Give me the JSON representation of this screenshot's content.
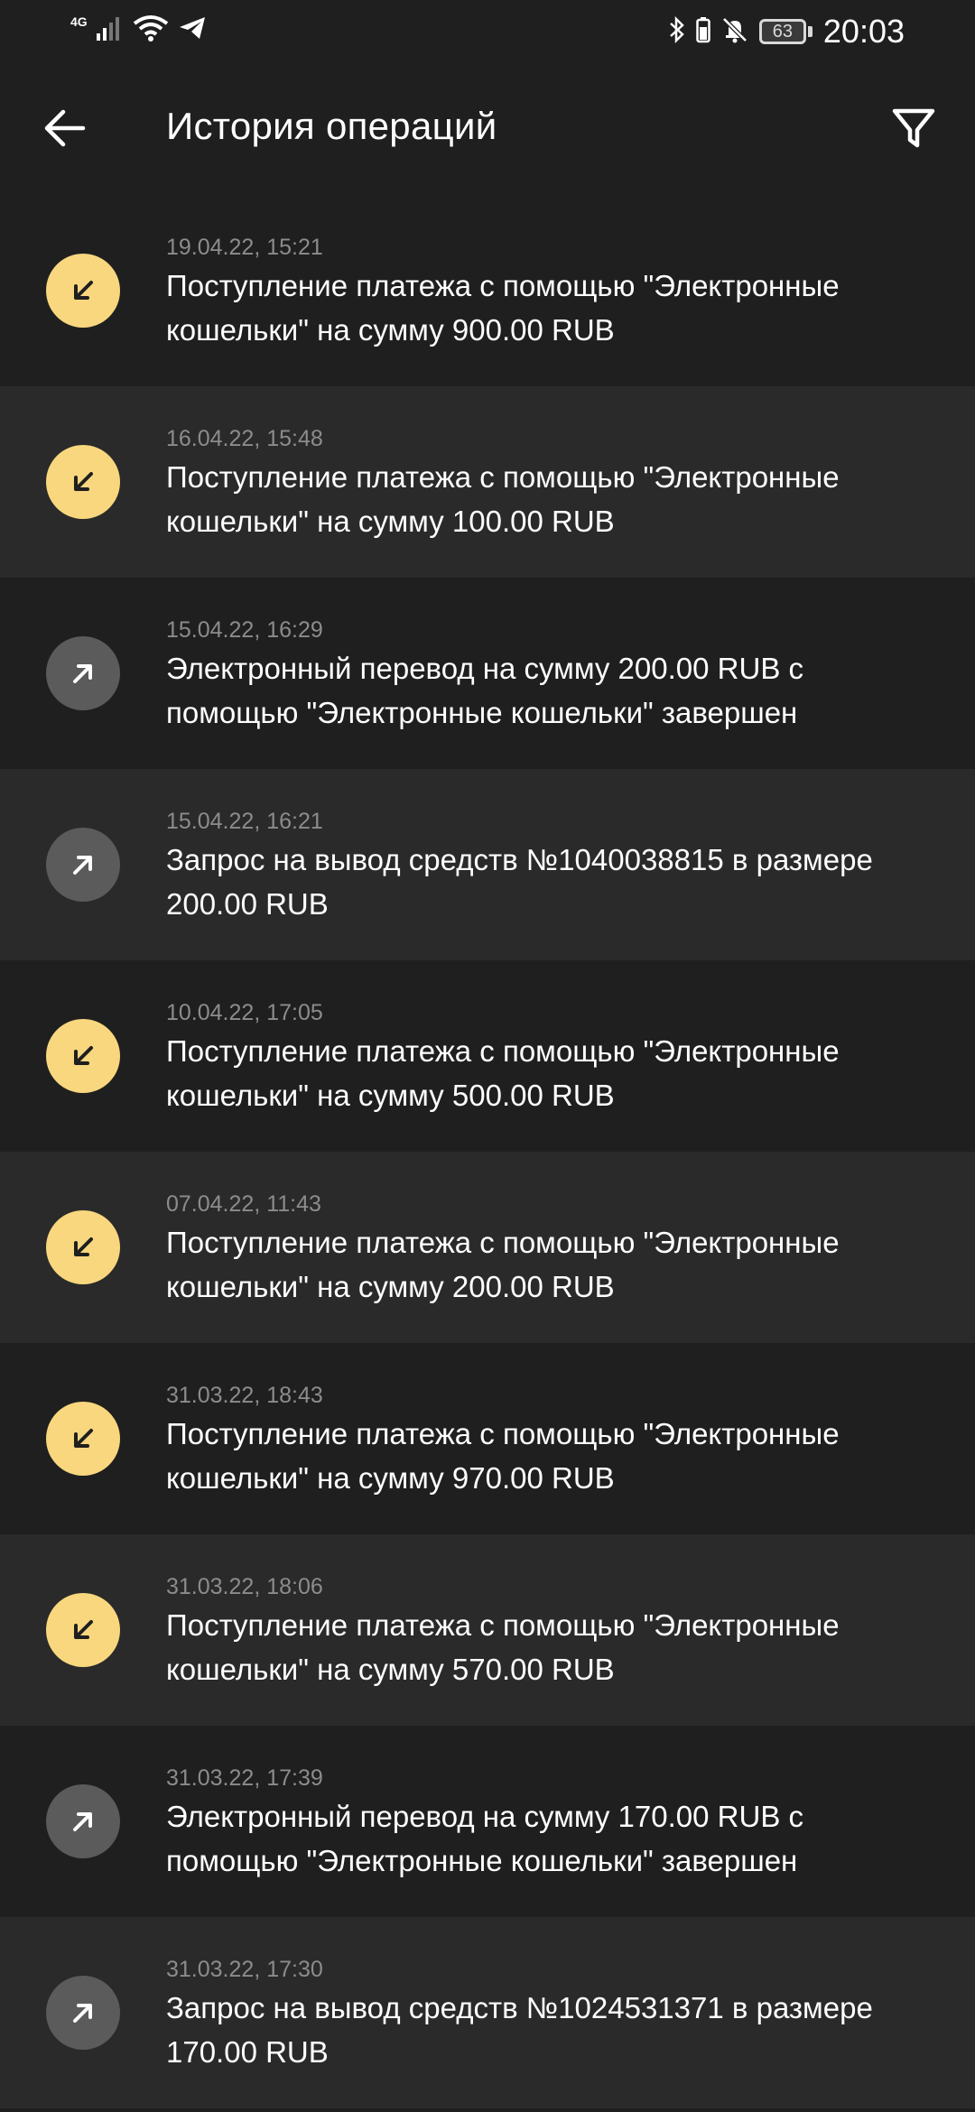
{
  "status_bar": {
    "network": "4G",
    "battery": "63",
    "time": "20:03"
  },
  "header": {
    "title": "История операций",
    "back_icon": "arrow-left-icon",
    "filter_icon": "filter-icon"
  },
  "colors": {
    "incoming": "#f9d77e",
    "outgoing": "#5b5b5b",
    "background": "#1f1f1f",
    "row_alt": "#2a2a2a"
  },
  "operations": [
    {
      "type": "incoming",
      "date": "19.04.22, 15:21",
      "text": "Поступление платежа с помощью \"Электронные кошельки\" на сумму 900.00 RUB"
    },
    {
      "type": "incoming",
      "date": "16.04.22, 15:48",
      "text": "Поступление платежа с помощью \"Электронные кошельки\" на сумму 100.00 RUB"
    },
    {
      "type": "outgoing",
      "date": "15.04.22, 16:29",
      "text": "Электронный перевод на сумму 200.00 RUB с помощью \"Электронные кошельки\" завершен"
    },
    {
      "type": "outgoing",
      "date": "15.04.22, 16:21",
      "text": "Запрос на вывод средств №1040038815 в размере 200.00 RUB"
    },
    {
      "type": "incoming",
      "date": "10.04.22, 17:05",
      "text": "Поступление платежа с помощью \"Электронные кошельки\" на сумму 500.00 RUB"
    },
    {
      "type": "incoming",
      "date": "07.04.22, 11:43",
      "text": "Поступление платежа с помощью \"Электронные кошельки\" на сумму 200.00 RUB"
    },
    {
      "type": "incoming",
      "date": "31.03.22, 18:43",
      "text": "Поступление платежа с помощью \"Электронные кошельки\" на сумму 970.00 RUB"
    },
    {
      "type": "incoming",
      "date": "31.03.22, 18:06",
      "text": "Поступление платежа с помощью \"Электронные кошельки\" на сумму 570.00 RUB"
    },
    {
      "type": "outgoing",
      "date": "31.03.22, 17:39",
      "text": "Электронный перевод на сумму 170.00 RUB с помощью \"Электронные кошельки\" завершен"
    },
    {
      "type": "outgoing",
      "date": "31.03.22, 17:30",
      "text": "Запрос на вывод средств №1024531371 в размере 170.00 RUB"
    }
  ]
}
